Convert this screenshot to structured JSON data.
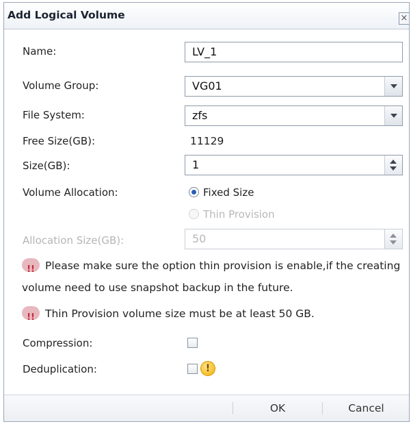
{
  "dialog": {
    "title": "Add Logical Volume",
    "close_glyph": "×"
  },
  "form": {
    "name_label": "Name:",
    "name_value": "LV_1",
    "volume_group_label": "Volume Group:",
    "volume_group_value": "VG01",
    "file_system_label": "File System:",
    "file_system_value": "zfs",
    "free_size_label": "Free Size(GB):",
    "free_size_value": "11129",
    "size_label": "Size(GB):",
    "size_value": "1",
    "volume_allocation_label": "Volume Allocation:",
    "fixed_size_label": "Fixed Size",
    "thin_provision_label": "Thin Provision",
    "allocation_size_label": "Allocation Size(GB):",
    "allocation_size_value": "50",
    "compression_label": "Compression:",
    "deduplication_label": "Deduplication:"
  },
  "messages": {
    "snapshot_note": "Please make sure the option thin provision is enable,if the creating volume need to use snapshot backup in the future.",
    "thin_min_note": "Thin Provision volume size must be at least 50 GB."
  },
  "footer": {
    "ok_label": "OK",
    "cancel_label": "Cancel"
  },
  "icons": {
    "warning": "warning-bubble-icon",
    "caution": "caution-icon",
    "close": "close-icon"
  },
  "state": {
    "allocation": "fixed",
    "compression": false,
    "deduplication": false
  }
}
